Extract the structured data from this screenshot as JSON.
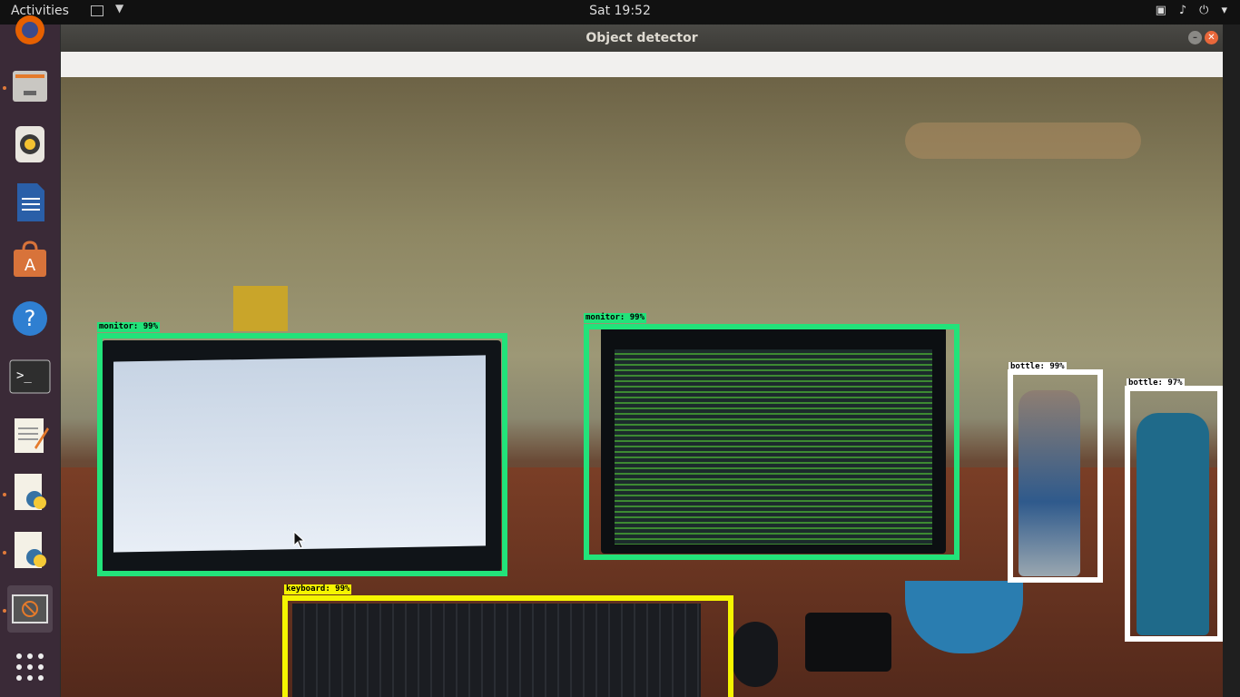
{
  "topbar": {
    "activities": "Activities",
    "clock": "Sat 19:52"
  },
  "window": {
    "title": "Object detector"
  },
  "detections": [
    {
      "label": "monitor: 99%",
      "class": "monitor",
      "score": 0.99,
      "color": "#22e37a"
    },
    {
      "label": "monitor: 99%",
      "class": "monitor",
      "score": 0.99,
      "color": "#22e37a"
    },
    {
      "label": "keyboard: 99%",
      "class": "keyboard",
      "score": 0.99,
      "color": "#f5f500"
    },
    {
      "label": "bottle: 99%",
      "class": "bottle",
      "score": 0.99,
      "color": "#ffffff"
    },
    {
      "label": "bottle: 97%",
      "class": "bottle",
      "score": 0.97,
      "color": "#ffffff"
    }
  ],
  "dock": {
    "items": [
      {
        "icon": "firefox-icon"
      },
      {
        "icon": "files-icon"
      },
      {
        "icon": "rhythmbox-icon"
      },
      {
        "icon": "libreoffice-writer-icon"
      },
      {
        "icon": "software-center-icon"
      },
      {
        "icon": "help-icon"
      },
      {
        "icon": "terminal-icon"
      },
      {
        "icon": "text-editor-icon"
      },
      {
        "icon": "python-file-icon"
      },
      {
        "icon": "python-file-icon"
      },
      {
        "icon": "object-detector-app-icon"
      },
      {
        "icon": "show-applications-icon"
      }
    ]
  }
}
